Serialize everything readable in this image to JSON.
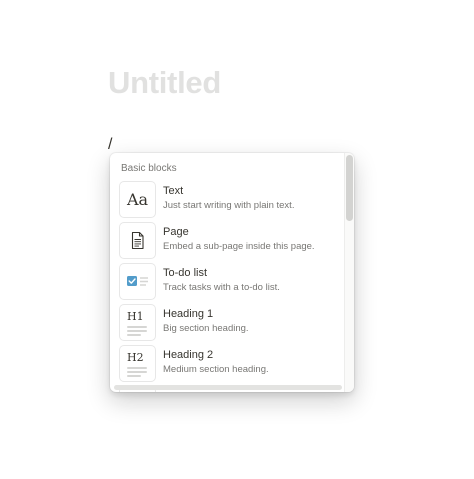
{
  "page": {
    "title": "Untitled",
    "slash": "/"
  },
  "menu": {
    "section_header": "Basic blocks",
    "items": [
      {
        "icon": "text-block-icon",
        "glyph": "Aa",
        "title": "Text",
        "description": "Just start writing with plain text."
      },
      {
        "icon": "page-document-icon",
        "title": "Page",
        "description": "Embed a sub-page inside this page."
      },
      {
        "icon": "todo-checkbox-icon",
        "title": "To-do list",
        "description": "Track tasks with a to-do list."
      },
      {
        "icon": "heading-1-icon",
        "glyph": "H1",
        "title": "Heading 1",
        "description": "Big section heading."
      },
      {
        "icon": "heading-2-icon",
        "glyph": "H2",
        "title": "Heading 2",
        "description": "Medium section heading."
      }
    ]
  },
  "colors": {
    "title_placeholder": "#e1e1e0",
    "text": "#37352f",
    "muted_text": "#787774",
    "checkbox_blue": "#529cca"
  }
}
